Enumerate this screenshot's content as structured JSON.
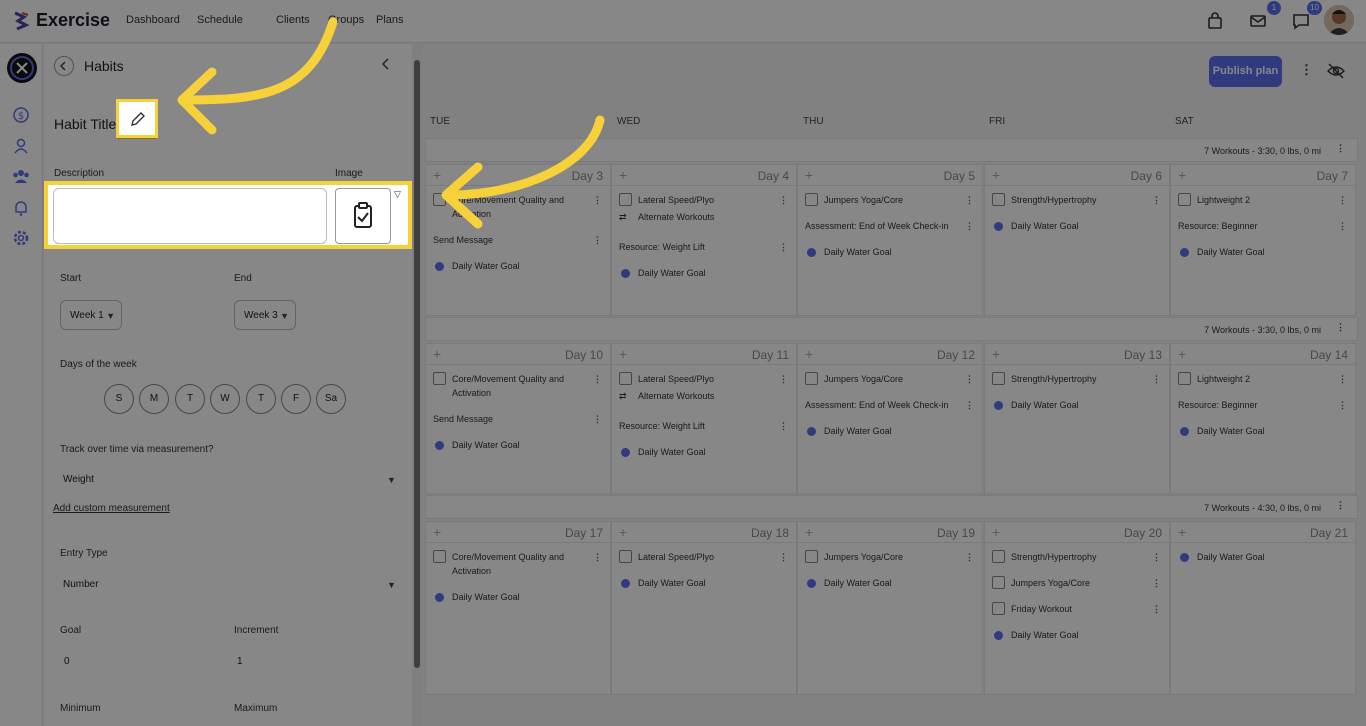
{
  "app": {
    "name": "Exercise"
  },
  "nav": [
    "Dashboard",
    "Schedule",
    "Clients",
    "Groups",
    "Plans"
  ],
  "badges": {
    "mail": "1",
    "chat": "10"
  },
  "panel": {
    "title": "Habits",
    "habit_title": "Habit Title",
    "description_label": "Description",
    "description_value": "",
    "image_label": "Image",
    "start_label": "Start",
    "start_value": "Week 1",
    "end_label": "End",
    "end_value": "Week 3",
    "days_label": "Days of the week",
    "days": [
      "S",
      "M",
      "T",
      "W",
      "T",
      "F",
      "Sa"
    ],
    "track_label": "Track over time via measurement?",
    "track_value": "Weight",
    "custom_link": "Add custom measurement",
    "entry_label": "Entry Type",
    "entry_value": "Number",
    "goal_label": "Goal",
    "goal_value": "0",
    "increment_label": "Increment",
    "increment_value": "1",
    "min_label": "Minimum",
    "max_label": "Maximum"
  },
  "calendar": {
    "publish_label": "Publish plan",
    "day_headers": [
      "TUE",
      "WED",
      "THU",
      "FRI",
      "SAT"
    ],
    "weeks": [
      {
        "summary": "7 Workouts - 3:30, 0 lbs, 0 mi",
        "days": [
          {
            "num": "Day 3",
            "items": [
              {
                "kind": "check",
                "text": "Core/Movement Quality and Activation"
              },
              {
                "kind": "plain",
                "text": "Send Message"
              },
              {
                "kind": "dot",
                "text": "Daily Water Goal"
              }
            ]
          },
          {
            "num": "Day 4",
            "items": [
              {
                "kind": "check",
                "text": "Lateral Speed/Plyo"
              },
              {
                "kind": "swap",
                "text": "Alternate Workouts"
              },
              {
                "kind": "plain",
                "text": "Resource: Weight Lift"
              },
              {
                "kind": "dot",
                "text": "Daily Water Goal"
              }
            ]
          },
          {
            "num": "Day 5",
            "items": [
              {
                "kind": "check",
                "text": "Jumpers Yoga/Core"
              },
              {
                "kind": "plain",
                "text": "Assessment: End of Week Check-in"
              },
              {
                "kind": "dot",
                "text": "Daily Water Goal"
              }
            ]
          },
          {
            "num": "Day 6",
            "items": [
              {
                "kind": "check",
                "text": "Strength/Hypertrophy"
              },
              {
                "kind": "dot",
                "text": "Daily Water Goal"
              }
            ]
          },
          {
            "num": "Day 7",
            "items": [
              {
                "kind": "check",
                "text": "Lightweight 2"
              },
              {
                "kind": "plain",
                "text": "Resource: Beginner"
              },
              {
                "kind": "dot",
                "text": "Daily Water Goal"
              }
            ]
          }
        ]
      },
      {
        "summary": "7 Workouts - 3:30, 0 lbs, 0 mi",
        "days": [
          {
            "num": "Day 10",
            "items": [
              {
                "kind": "check",
                "text": "Core/Movement Quality and Activation"
              },
              {
                "kind": "plain",
                "text": "Send Message"
              },
              {
                "kind": "dot",
                "text": "Daily Water Goal"
              }
            ]
          },
          {
            "num": "Day 11",
            "items": [
              {
                "kind": "check",
                "text": "Lateral Speed/Plyo"
              },
              {
                "kind": "swap",
                "text": "Alternate Workouts"
              },
              {
                "kind": "plain",
                "text": "Resource: Weight Lift"
              },
              {
                "kind": "dot",
                "text": "Daily Water Goal"
              }
            ]
          },
          {
            "num": "Day 12",
            "items": [
              {
                "kind": "check",
                "text": "Jumpers Yoga/Core"
              },
              {
                "kind": "plain",
                "text": "Assessment: End of Week Check-in"
              },
              {
                "kind": "dot",
                "text": "Daily Water Goal"
              }
            ]
          },
          {
            "num": "Day 13",
            "items": [
              {
                "kind": "check",
                "text": "Strength/Hypertrophy"
              },
              {
                "kind": "dot",
                "text": "Daily Water Goal"
              }
            ]
          },
          {
            "num": "Day 14",
            "items": [
              {
                "kind": "check",
                "text": "Lightweight 2"
              },
              {
                "kind": "plain",
                "text": "Resource: Beginner"
              },
              {
                "kind": "dot",
                "text": "Daily Water Goal"
              }
            ]
          }
        ]
      },
      {
        "summary": "7 Workouts - 4:30, 0 lbs, 0 mi",
        "days": [
          {
            "num": "Day 17",
            "items": [
              {
                "kind": "check",
                "text": "Core/Movement Quality and Activation"
              },
              {
                "kind": "dot",
                "text": "Daily Water Goal"
              }
            ]
          },
          {
            "num": "Day 18",
            "items": [
              {
                "kind": "check",
                "text": "Lateral Speed/Plyo"
              },
              {
                "kind": "dot",
                "text": "Daily Water Goal"
              }
            ]
          },
          {
            "num": "Day 19",
            "items": [
              {
                "kind": "check",
                "text": "Jumpers Yoga/Core"
              },
              {
                "kind": "dot",
                "text": "Daily Water Goal"
              }
            ]
          },
          {
            "num": "Day 20",
            "items": [
              {
                "kind": "check",
                "text": "Strength/Hypertrophy"
              },
              {
                "kind": "check",
                "text": "Jumpers Yoga/Core"
              },
              {
                "kind": "check",
                "text": "Friday Workout"
              },
              {
                "kind": "dot",
                "text": "Daily Water Goal"
              }
            ]
          },
          {
            "num": "Day 21",
            "items": [
              {
                "kind": "dot",
                "text": "Daily Water Goal"
              }
            ]
          }
        ]
      }
    ]
  },
  "colors": {
    "accent": "#5b6ef0",
    "highlight": "#f7d13a"
  }
}
